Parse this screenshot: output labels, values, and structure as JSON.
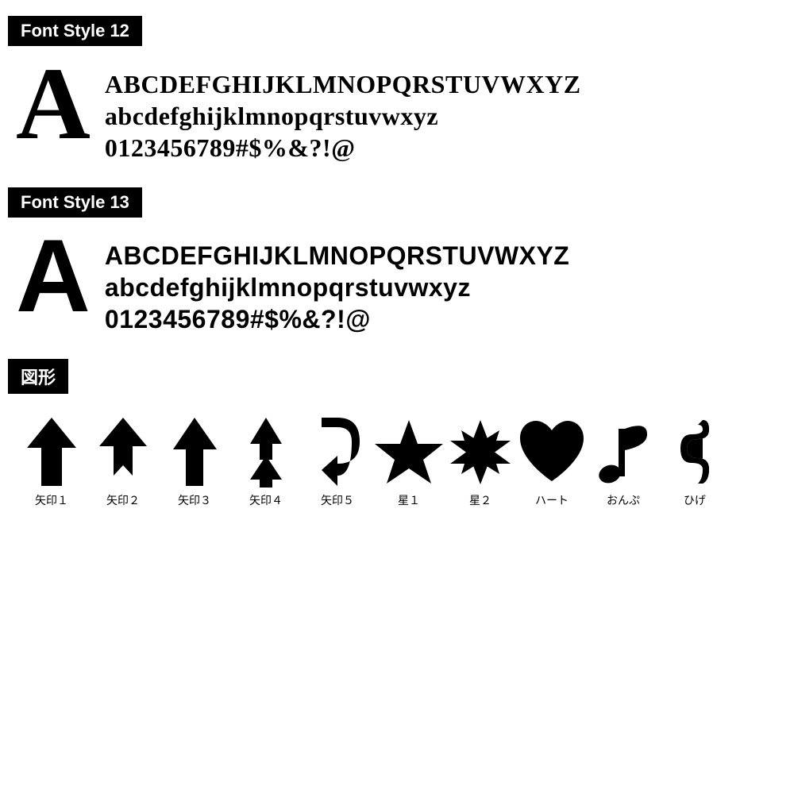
{
  "font12": {
    "header": "Font Style 12",
    "big_letter": "A",
    "line1": "ABCDEFGHIJKLMNOPQRSTUVWXYZ",
    "line2": "abcdefghijklmnopqrstuvwxyz",
    "line3": "0123456789#$%&?!@"
  },
  "font13": {
    "header": "Font Style 13",
    "big_letter": "A",
    "line1": "ABCDEFGHIJKLMNOPQRSTUVWXYZ",
    "line2": "abcdefghijklmnopqrstuvwxyz",
    "line3": "0123456789#$%&?!@"
  },
  "figures": {
    "header": "図形",
    "items": [
      {
        "label": "矢印１",
        "type": "arrow1"
      },
      {
        "label": "矢印２",
        "type": "arrow2"
      },
      {
        "label": "矢印３",
        "type": "arrow3"
      },
      {
        "label": "矢印４",
        "type": "arrow4"
      },
      {
        "label": "矢印５",
        "type": "arrow5"
      },
      {
        "label": "星１",
        "type": "star1"
      },
      {
        "label": "星２",
        "type": "star2"
      },
      {
        "label": "ハート",
        "type": "heart"
      },
      {
        "label": "おんぷ",
        "type": "music"
      },
      {
        "label": "ひげ",
        "type": "moustache"
      }
    ]
  }
}
